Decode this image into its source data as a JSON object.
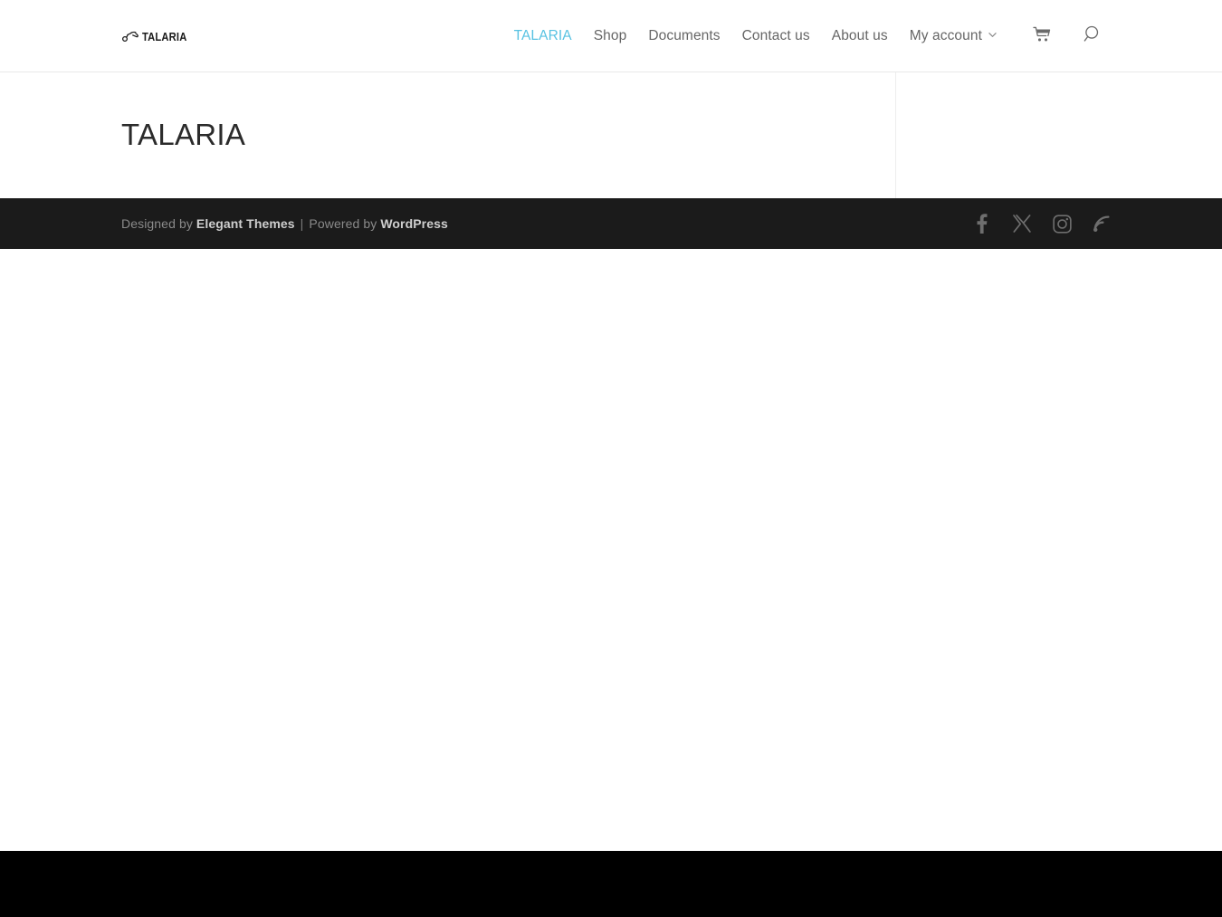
{
  "site": {
    "logo_text": "TALARIA",
    "logo_icon": "motorcycle-icon"
  },
  "header": {
    "nav_items": [
      {
        "label": "TALARIA",
        "active": true,
        "has_dropdown": false
      },
      {
        "label": "Shop",
        "active": false,
        "has_dropdown": false
      },
      {
        "label": "Documents",
        "active": false,
        "has_dropdown": false
      },
      {
        "label": "Contact us",
        "active": false,
        "has_dropdown": false
      },
      {
        "label": "About us",
        "active": false,
        "has_dropdown": false
      },
      {
        "label": "My account",
        "active": false,
        "has_dropdown": true
      }
    ],
    "cart_icon": "shopping-cart-icon",
    "search_icon": "search-icon",
    "active_color": "#58c2e2",
    "link_color": "#666666"
  },
  "main": {
    "page_title": "TALARIA"
  },
  "footer": {
    "credit_prefix": "Designed by ",
    "credit_link_1": "Elegant Themes",
    "credit_separator": " | ",
    "credit_middle": "Powered by ",
    "credit_link_2": "WordPress",
    "background": "#1b1b1b",
    "social": [
      {
        "name": "facebook",
        "label": "Facebook"
      },
      {
        "name": "x-twitter",
        "label": "X"
      },
      {
        "name": "instagram",
        "label": "Instagram"
      },
      {
        "name": "rss",
        "label": "RSS Feed"
      }
    ]
  }
}
